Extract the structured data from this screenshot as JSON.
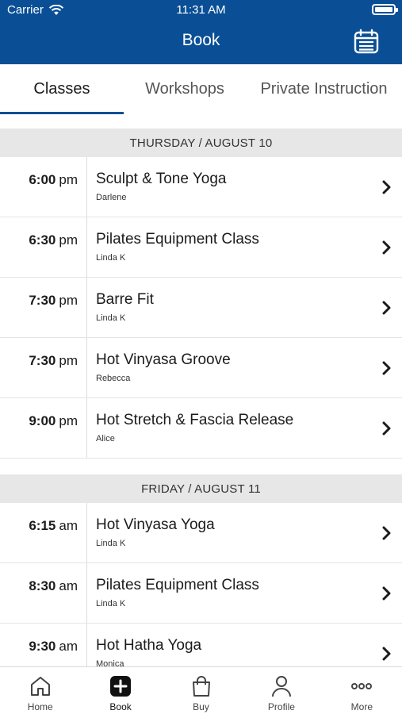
{
  "status_bar": {
    "carrier": "Carrier",
    "time": "11:31 AM"
  },
  "header": {
    "title": "Book"
  },
  "tabs": [
    {
      "label": "Classes",
      "active": true
    },
    {
      "label": "Workshops",
      "active": false
    },
    {
      "label": "Private Instruction",
      "active": false
    }
  ],
  "days": [
    {
      "header": "THURSDAY / AUGUST 10",
      "classes": [
        {
          "time": "6:00",
          "ampm": "pm",
          "name": "Sculpt & Tone Yoga",
          "instructor": "Darlene"
        },
        {
          "time": "6:30",
          "ampm": "pm",
          "name": "Pilates Equipment Class",
          "instructor": "Linda K"
        },
        {
          "time": "7:30",
          "ampm": "pm",
          "name": "Barre Fit",
          "instructor": "Linda K"
        },
        {
          "time": "7:30",
          "ampm": "pm",
          "name": "Hot Vinyasa Groove",
          "instructor": "Rebecca"
        },
        {
          "time": "9:00",
          "ampm": "pm",
          "name": "Hot Stretch & Fascia Release",
          "instructor": "Alice"
        }
      ]
    },
    {
      "header": "FRIDAY / AUGUST 11",
      "classes": [
        {
          "time": "6:15",
          "ampm": "am",
          "name": "Hot Vinyasa Yoga",
          "instructor": "Linda K"
        },
        {
          "time": "8:30",
          "ampm": "am",
          "name": "Pilates Equipment Class",
          "instructor": "Linda K"
        },
        {
          "time": "9:30",
          "ampm": "am",
          "name": "Hot Hatha Yoga",
          "instructor": "Monica"
        }
      ]
    }
  ],
  "tabbar": [
    {
      "label": "Home",
      "icon": "home-icon"
    },
    {
      "label": "Book",
      "icon": "book-plus-icon",
      "active": true
    },
    {
      "label": "Buy",
      "icon": "shopping-bag-icon"
    },
    {
      "label": "Profile",
      "icon": "profile-icon"
    },
    {
      "label": "More",
      "icon": "more-icon"
    }
  ],
  "colors": {
    "header_bg": "#0a4f96",
    "tab_underline": "#0a4f96",
    "date_header_bg": "#e7e7e7"
  }
}
